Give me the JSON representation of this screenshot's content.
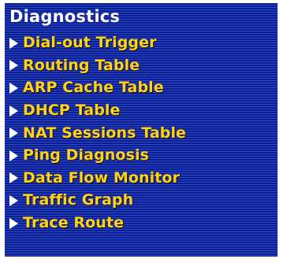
{
  "header": {
    "title": "Diagnostics"
  },
  "menu": {
    "items": [
      {
        "label": "Dial-out Trigger",
        "icon": "triangle-right-icon"
      },
      {
        "label": "Routing Table",
        "icon": "triangle-right-icon"
      },
      {
        "label": "ARP Cache Table",
        "icon": "triangle-right-icon"
      },
      {
        "label": "DHCP Table",
        "icon": "triangle-right-icon"
      },
      {
        "label": "NAT Sessions Table",
        "icon": "triangle-right-icon"
      },
      {
        "label": "Ping Diagnosis",
        "icon": "triangle-right-icon"
      },
      {
        "label": "Data Flow Monitor",
        "icon": "triangle-right-icon"
      },
      {
        "label": "Traffic Graph",
        "icon": "triangle-right-icon"
      },
      {
        "label": "Trace Route",
        "icon": "triangle-right-icon"
      }
    ]
  },
  "colors": {
    "panel_background": "#0c1e8c",
    "stripe": "#2b49cf",
    "title_text": "#ffffff",
    "item_text": "#ffd21a",
    "arrow": "#ffffff"
  }
}
